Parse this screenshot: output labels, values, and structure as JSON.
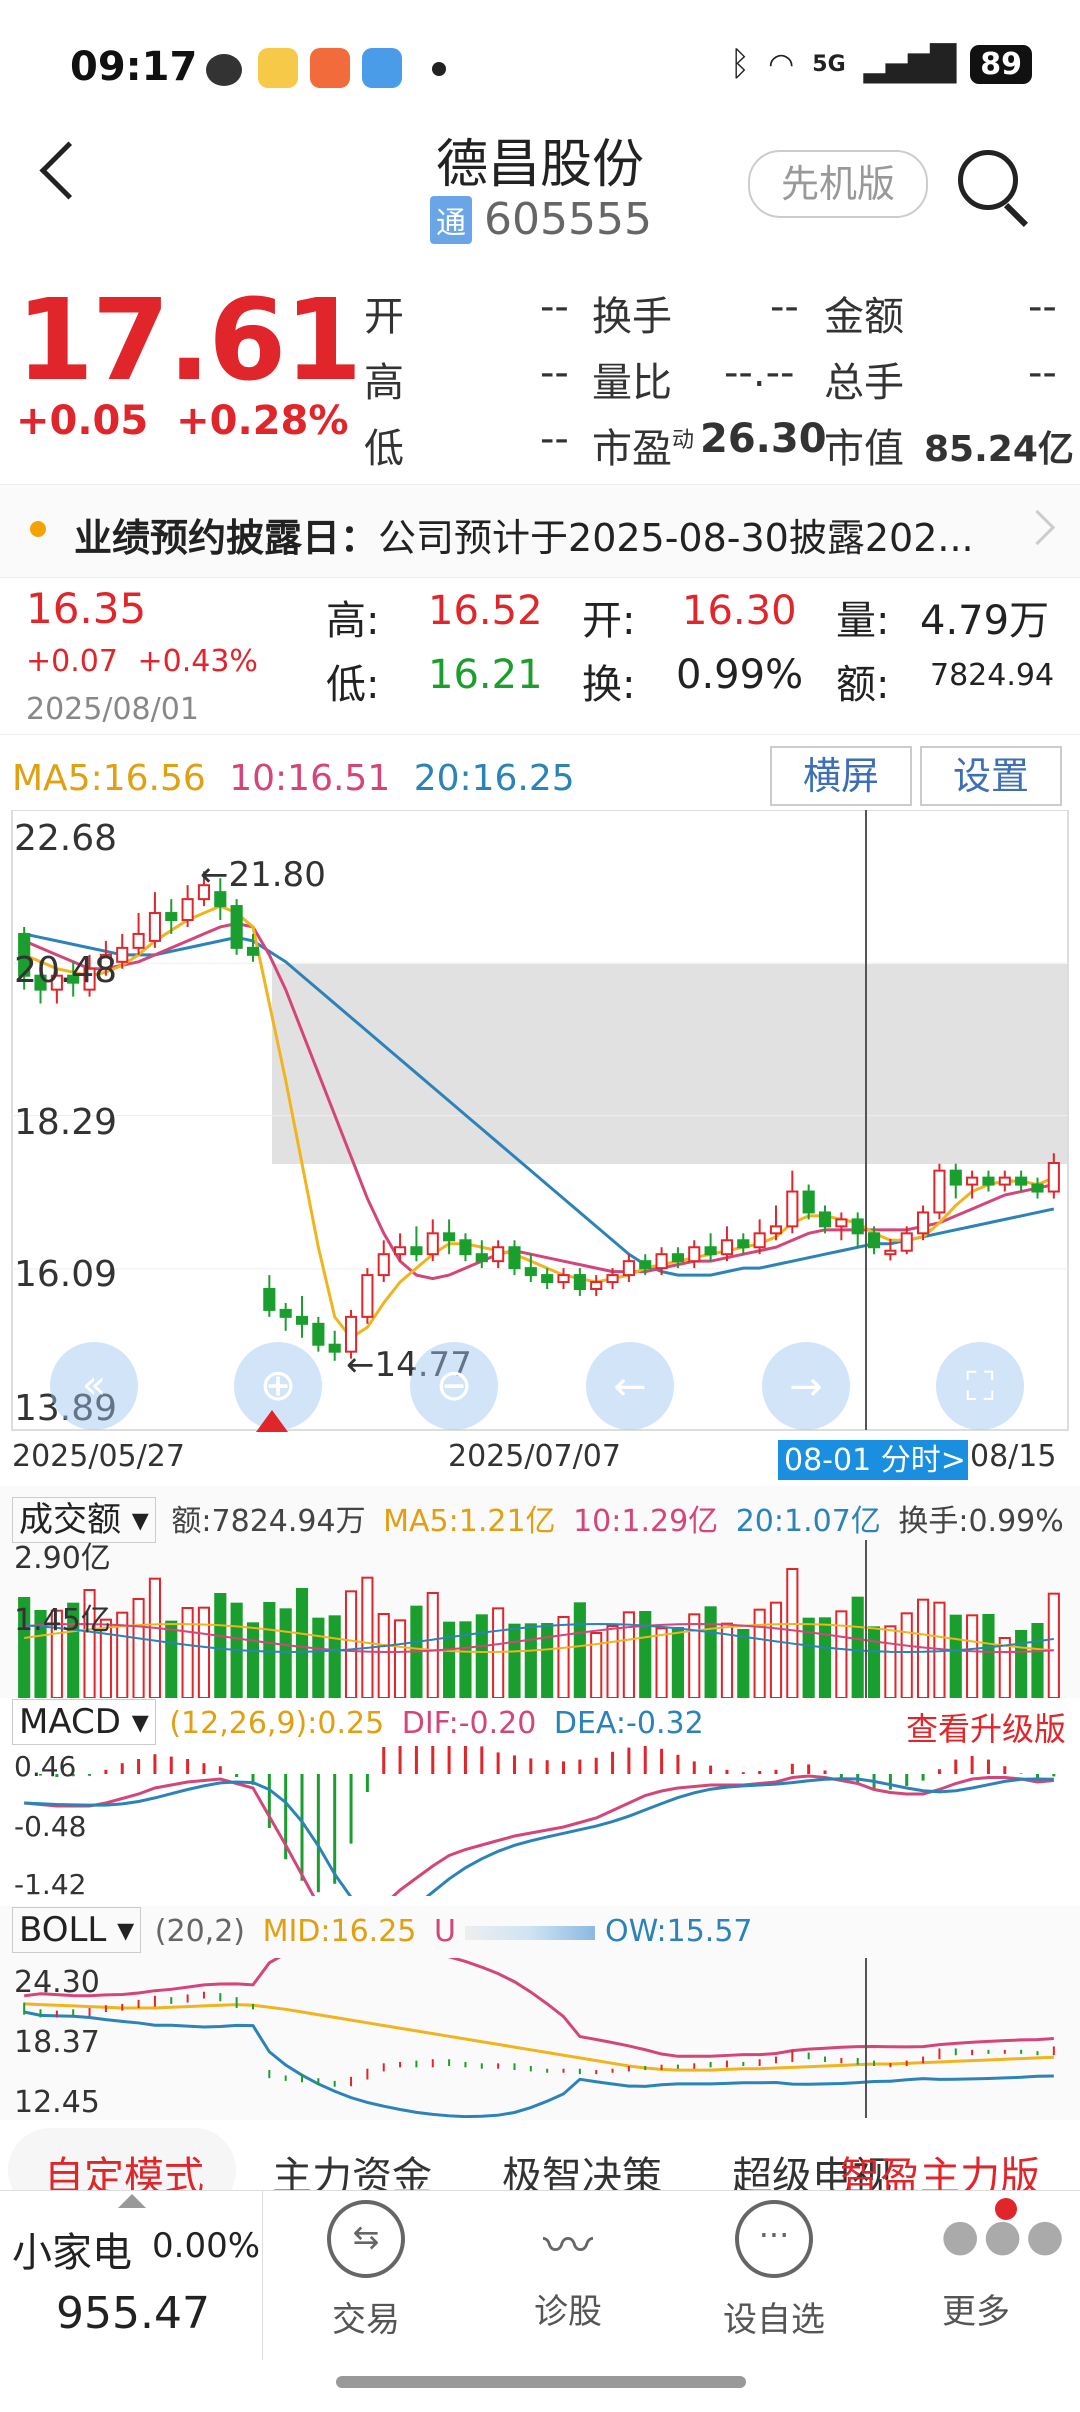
{
  "status_bar": {
    "time": "09:17",
    "network": "5G",
    "battery": "89"
  },
  "header": {
    "back_icon": "chevron-left-icon",
    "stock_name": "德昌股份",
    "tong_badge": "通",
    "stock_code": "605555",
    "pro_button": "先机版",
    "search_icon": "search-icon"
  },
  "quote": {
    "price": "17.61",
    "change": "+0.05",
    "change_pct": "+0.28%",
    "rows": [
      [
        {
          "label": "开",
          "value": "--"
        },
        {
          "label": "换手",
          "value": "--"
        },
        {
          "label": "金额",
          "value": "--"
        }
      ],
      [
        {
          "label": "高",
          "value": "--"
        },
        {
          "label": "量比",
          "value": "--.--"
        },
        {
          "label": "总手",
          "value": "--"
        }
      ],
      [
        {
          "label": "低",
          "value": "--"
        },
        {
          "label": "市盈",
          "sup": "动",
          "value": "26.30"
        },
        {
          "label": "市值",
          "value": "85.24亿"
        }
      ]
    ]
  },
  "notice": {
    "label": "业绩预约披露日：",
    "text": "公司预计于2025-08-30披露202..."
  },
  "day_info": {
    "close": "16.35",
    "change": "+0.07",
    "change_pct": "+0.43%",
    "date": "2025/08/01",
    "high_label": "高:",
    "high": "16.52",
    "open_label": "开:",
    "open": "16.30",
    "vol_label": "量:",
    "vol": "4.79万",
    "low_label": "低:",
    "low": "16.21",
    "turn_label": "换:",
    "turn": "0.99%",
    "amt_label": "额:",
    "amt": "7824.94"
  },
  "chart_header": {
    "ma5": "MA5:16.56",
    "ma10": "10:16.51",
    "ma20": "20:16.25",
    "landscape_button": "横屏",
    "settings_button": "设置"
  },
  "kline": {
    "y_labels": [
      "22.68",
      "20.48",
      "18.29",
      "16.09",
      "13.89"
    ],
    "x_labels": [
      "2025/05/27",
      "2025/07/07",
      "08/15"
    ],
    "cursor_label": "08-01 分时>",
    "high_marker": "←21.80",
    "low_marker": "←14.77"
  },
  "volume_panel": {
    "title": "成交额",
    "amount": "额:7824.94万",
    "ma5": "MA5:1.21亿",
    "ma10": "10:1.29亿",
    "ma20": "20:1.07亿",
    "turnover": "换手:0.99%",
    "y_labels": [
      "2.90亿",
      "1.45亿"
    ]
  },
  "macd_panel": {
    "title": "MACD",
    "params": "(12,26,9):0.25",
    "dif": "DIF:-0.20",
    "dea": "DEA:-0.32",
    "upgrade": "查看升级版",
    "y_labels": [
      "0.46",
      "-0.48",
      "-1.42"
    ]
  },
  "boll_panel": {
    "title": "BOLL",
    "params": "(20,2)",
    "mid": "MID:16.25",
    "up": "U",
    "low": "OW:15.57",
    "y_labels": [
      "24.30",
      "18.37",
      "12.45"
    ]
  },
  "mode_tabs": [
    "自定模式",
    "主力资金",
    "极智决策",
    "超级电视",
    "智盈主力版"
  ],
  "footer": {
    "index_name": "小家电",
    "index_pct": "0.00%",
    "index_value": "955.47",
    "items": [
      {
        "label": "交易",
        "icon": "trade-icon"
      },
      {
        "label": "诊股",
        "icon": "diagnose-icon"
      },
      {
        "label": "设自选",
        "icon": "add-watchlist-icon"
      },
      {
        "label": "更多",
        "icon": "more-icon"
      }
    ]
  },
  "colors": {
    "up": "#e0262b",
    "down": "#1a9e2e",
    "ma5": "#f0b41e",
    "ma10": "#d4457a",
    "ma20": "#2b83b8",
    "accent": "#3d6fb6"
  },
  "chart_data": {
    "type": "candlestick",
    "x_range": [
      "2025/05/27",
      "2025/08/15"
    ],
    "ylim": [
      13.89,
      22.68
    ],
    "candles": [
      [
        20.9,
        20.3,
        21.0,
        20.1
      ],
      [
        20.3,
        20.1,
        20.5,
        19.9
      ],
      [
        20.1,
        20.3,
        20.4,
        19.9
      ],
      [
        20.3,
        20.2,
        20.5,
        20.0
      ],
      [
        20.1,
        20.4,
        20.6,
        20.0
      ],
      [
        20.4,
        20.6,
        20.8,
        20.3
      ],
      [
        20.5,
        20.7,
        20.9,
        20.4
      ],
      [
        20.7,
        20.9,
        21.2,
        20.6
      ],
      [
        20.8,
        21.2,
        21.5,
        20.7
      ],
      [
        21.2,
        21.1,
        21.4,
        20.9
      ],
      [
        21.1,
        21.4,
        21.6,
        21.0
      ],
      [
        21.4,
        21.6,
        21.8,
        21.3
      ],
      [
        21.5,
        21.3,
        21.7,
        21.1
      ],
      [
        21.3,
        20.7,
        21.4,
        20.6
      ],
      [
        20.7,
        20.6,
        20.9,
        20.5
      ],
      [
        15.8,
        15.5,
        16.0,
        15.4
      ],
      [
        15.5,
        15.4,
        15.6,
        15.2
      ],
      [
        15.4,
        15.3,
        15.7,
        15.1
      ],
      [
        15.3,
        15.0,
        15.4,
        14.9
      ],
      [
        15.0,
        14.9,
        15.2,
        14.77
      ],
      [
        14.9,
        15.4,
        15.5,
        14.8
      ],
      [
        15.4,
        16.0,
        16.1,
        15.3
      ],
      [
        16.0,
        16.3,
        16.5,
        15.9
      ],
      [
        16.3,
        16.4,
        16.6,
        16.2
      ],
      [
        16.4,
        16.3,
        16.7,
        16.2
      ],
      [
        16.3,
        16.6,
        16.8,
        16.2
      ],
      [
        16.6,
        16.5,
        16.8,
        16.3
      ],
      [
        16.5,
        16.3,
        16.6,
        16.2
      ],
      [
        16.3,
        16.2,
        16.5,
        16.1
      ],
      [
        16.2,
        16.4,
        16.5,
        16.1
      ],
      [
        16.4,
        16.1,
        16.5,
        16.0
      ],
      [
        16.1,
        16.0,
        16.3,
        15.9
      ],
      [
        16.0,
        15.9,
        16.1,
        15.8
      ],
      [
        15.9,
        16.0,
        16.1,
        15.8
      ],
      [
        16.0,
        15.8,
        16.1,
        15.7
      ],
      [
        15.8,
        15.9,
        16.0,
        15.7
      ],
      [
        15.9,
        16.0,
        16.1,
        15.8
      ],
      [
        16.0,
        16.2,
        16.3,
        15.9
      ],
      [
        16.2,
        16.1,
        16.3,
        16.0
      ],
      [
        16.1,
        16.3,
        16.4,
        16.0
      ],
      [
        16.3,
        16.2,
        16.4,
        16.1
      ],
      [
        16.2,
        16.4,
        16.5,
        16.1
      ],
      [
        16.4,
        16.3,
        16.6,
        16.2
      ],
      [
        16.3,
        16.5,
        16.7,
        16.2
      ],
      [
        16.5,
        16.4,
        16.6,
        16.3
      ],
      [
        16.4,
        16.6,
        16.8,
        16.3
      ],
      [
        16.6,
        16.7,
        17.0,
        16.5
      ],
      [
        16.7,
        17.2,
        17.5,
        16.6
      ],
      [
        17.2,
        16.9,
        17.3,
        16.8
      ],
      [
        16.9,
        16.7,
        17.0,
        16.6
      ],
      [
        16.7,
        16.8,
        16.9,
        16.5
      ],
      [
        16.8,
        16.6,
        16.9,
        16.4
      ],
      [
        16.6,
        16.4,
        16.7,
        16.3
      ],
      [
        16.3,
        16.35,
        16.52,
        16.21
      ],
      [
        16.35,
        16.6,
        16.7,
        16.3
      ],
      [
        16.6,
        16.9,
        17.0,
        16.5
      ],
      [
        16.9,
        17.5,
        17.6,
        16.8
      ],
      [
        17.5,
        17.3,
        17.6,
        17.1
      ],
      [
        17.3,
        17.4,
        17.5,
        17.1
      ],
      [
        17.4,
        17.3,
        17.5,
        17.2
      ],
      [
        17.3,
        17.4,
        17.5,
        17.2
      ],
      [
        17.4,
        17.3,
        17.5,
        17.2
      ],
      [
        17.3,
        17.2,
        17.4,
        17.1
      ],
      [
        17.2,
        17.61,
        17.75,
        17.1
      ]
    ],
    "ma5": [
      20.6,
      20.5,
      20.4,
      20.35,
      20.3,
      20.35,
      20.45,
      20.6,
      20.8,
      20.95,
      21.1,
      21.2,
      21.3,
      21.2,
      21.0,
      19.9,
      18.8,
      17.6,
      16.4,
      15.4,
      15.1,
      15.25,
      15.6,
      15.9,
      16.1,
      16.3,
      16.45,
      16.45,
      16.4,
      16.35,
      16.3,
      16.2,
      16.1,
      16.0,
      15.95,
      15.9,
      15.95,
      16.0,
      16.1,
      16.15,
      16.2,
      16.25,
      16.3,
      16.35,
      16.4,
      16.45,
      16.55,
      16.75,
      16.85,
      16.85,
      16.8,
      16.75,
      16.6,
      16.5,
      16.5,
      16.55,
      16.75,
      17.0,
      17.2,
      17.3,
      17.35,
      17.35,
      17.3,
      17.4
    ],
    "ma10": [
      20.8,
      20.7,
      20.6,
      20.5,
      20.4,
      20.4,
      20.45,
      20.5,
      20.6,
      20.7,
      20.8,
      20.9,
      21.0,
      21.05,
      21.0,
      20.6,
      20.1,
      19.5,
      18.9,
      18.3,
      17.7,
      17.1,
      16.6,
      16.2,
      16.0,
      15.95,
      16.0,
      16.1,
      16.2,
      16.3,
      16.35,
      16.3,
      16.25,
      16.2,
      16.15,
      16.1,
      16.05,
      16.05,
      16.05,
      16.1,
      16.15,
      16.2,
      16.2,
      16.25,
      16.3,
      16.35,
      16.4,
      16.5,
      16.6,
      16.65,
      16.65,
      16.65,
      16.65,
      16.65,
      16.65,
      16.7,
      16.75,
      16.85,
      16.95,
      17.05,
      17.15,
      17.2,
      17.25,
      17.3
    ],
    "ma20": [
      20.9,
      20.85,
      20.8,
      20.75,
      20.7,
      20.65,
      20.6,
      20.6,
      20.6,
      20.65,
      20.7,
      20.75,
      20.8,
      20.85,
      20.8,
      20.65,
      20.5,
      20.3,
      20.1,
      19.9,
      19.7,
      19.5,
      19.3,
      19.1,
      18.9,
      18.7,
      18.5,
      18.3,
      18.1,
      17.9,
      17.7,
      17.5,
      17.3,
      17.1,
      16.9,
      16.7,
      16.5,
      16.3,
      16.15,
      16.05,
      16.0,
      16.0,
      16.0,
      16.05,
      16.1,
      16.1,
      16.15,
      16.2,
      16.25,
      16.3,
      16.35,
      16.4,
      16.45,
      16.45,
      16.5,
      16.55,
      16.6,
      16.65,
      16.7,
      16.75,
      16.8,
      16.85,
      16.9,
      16.95
    ]
  }
}
